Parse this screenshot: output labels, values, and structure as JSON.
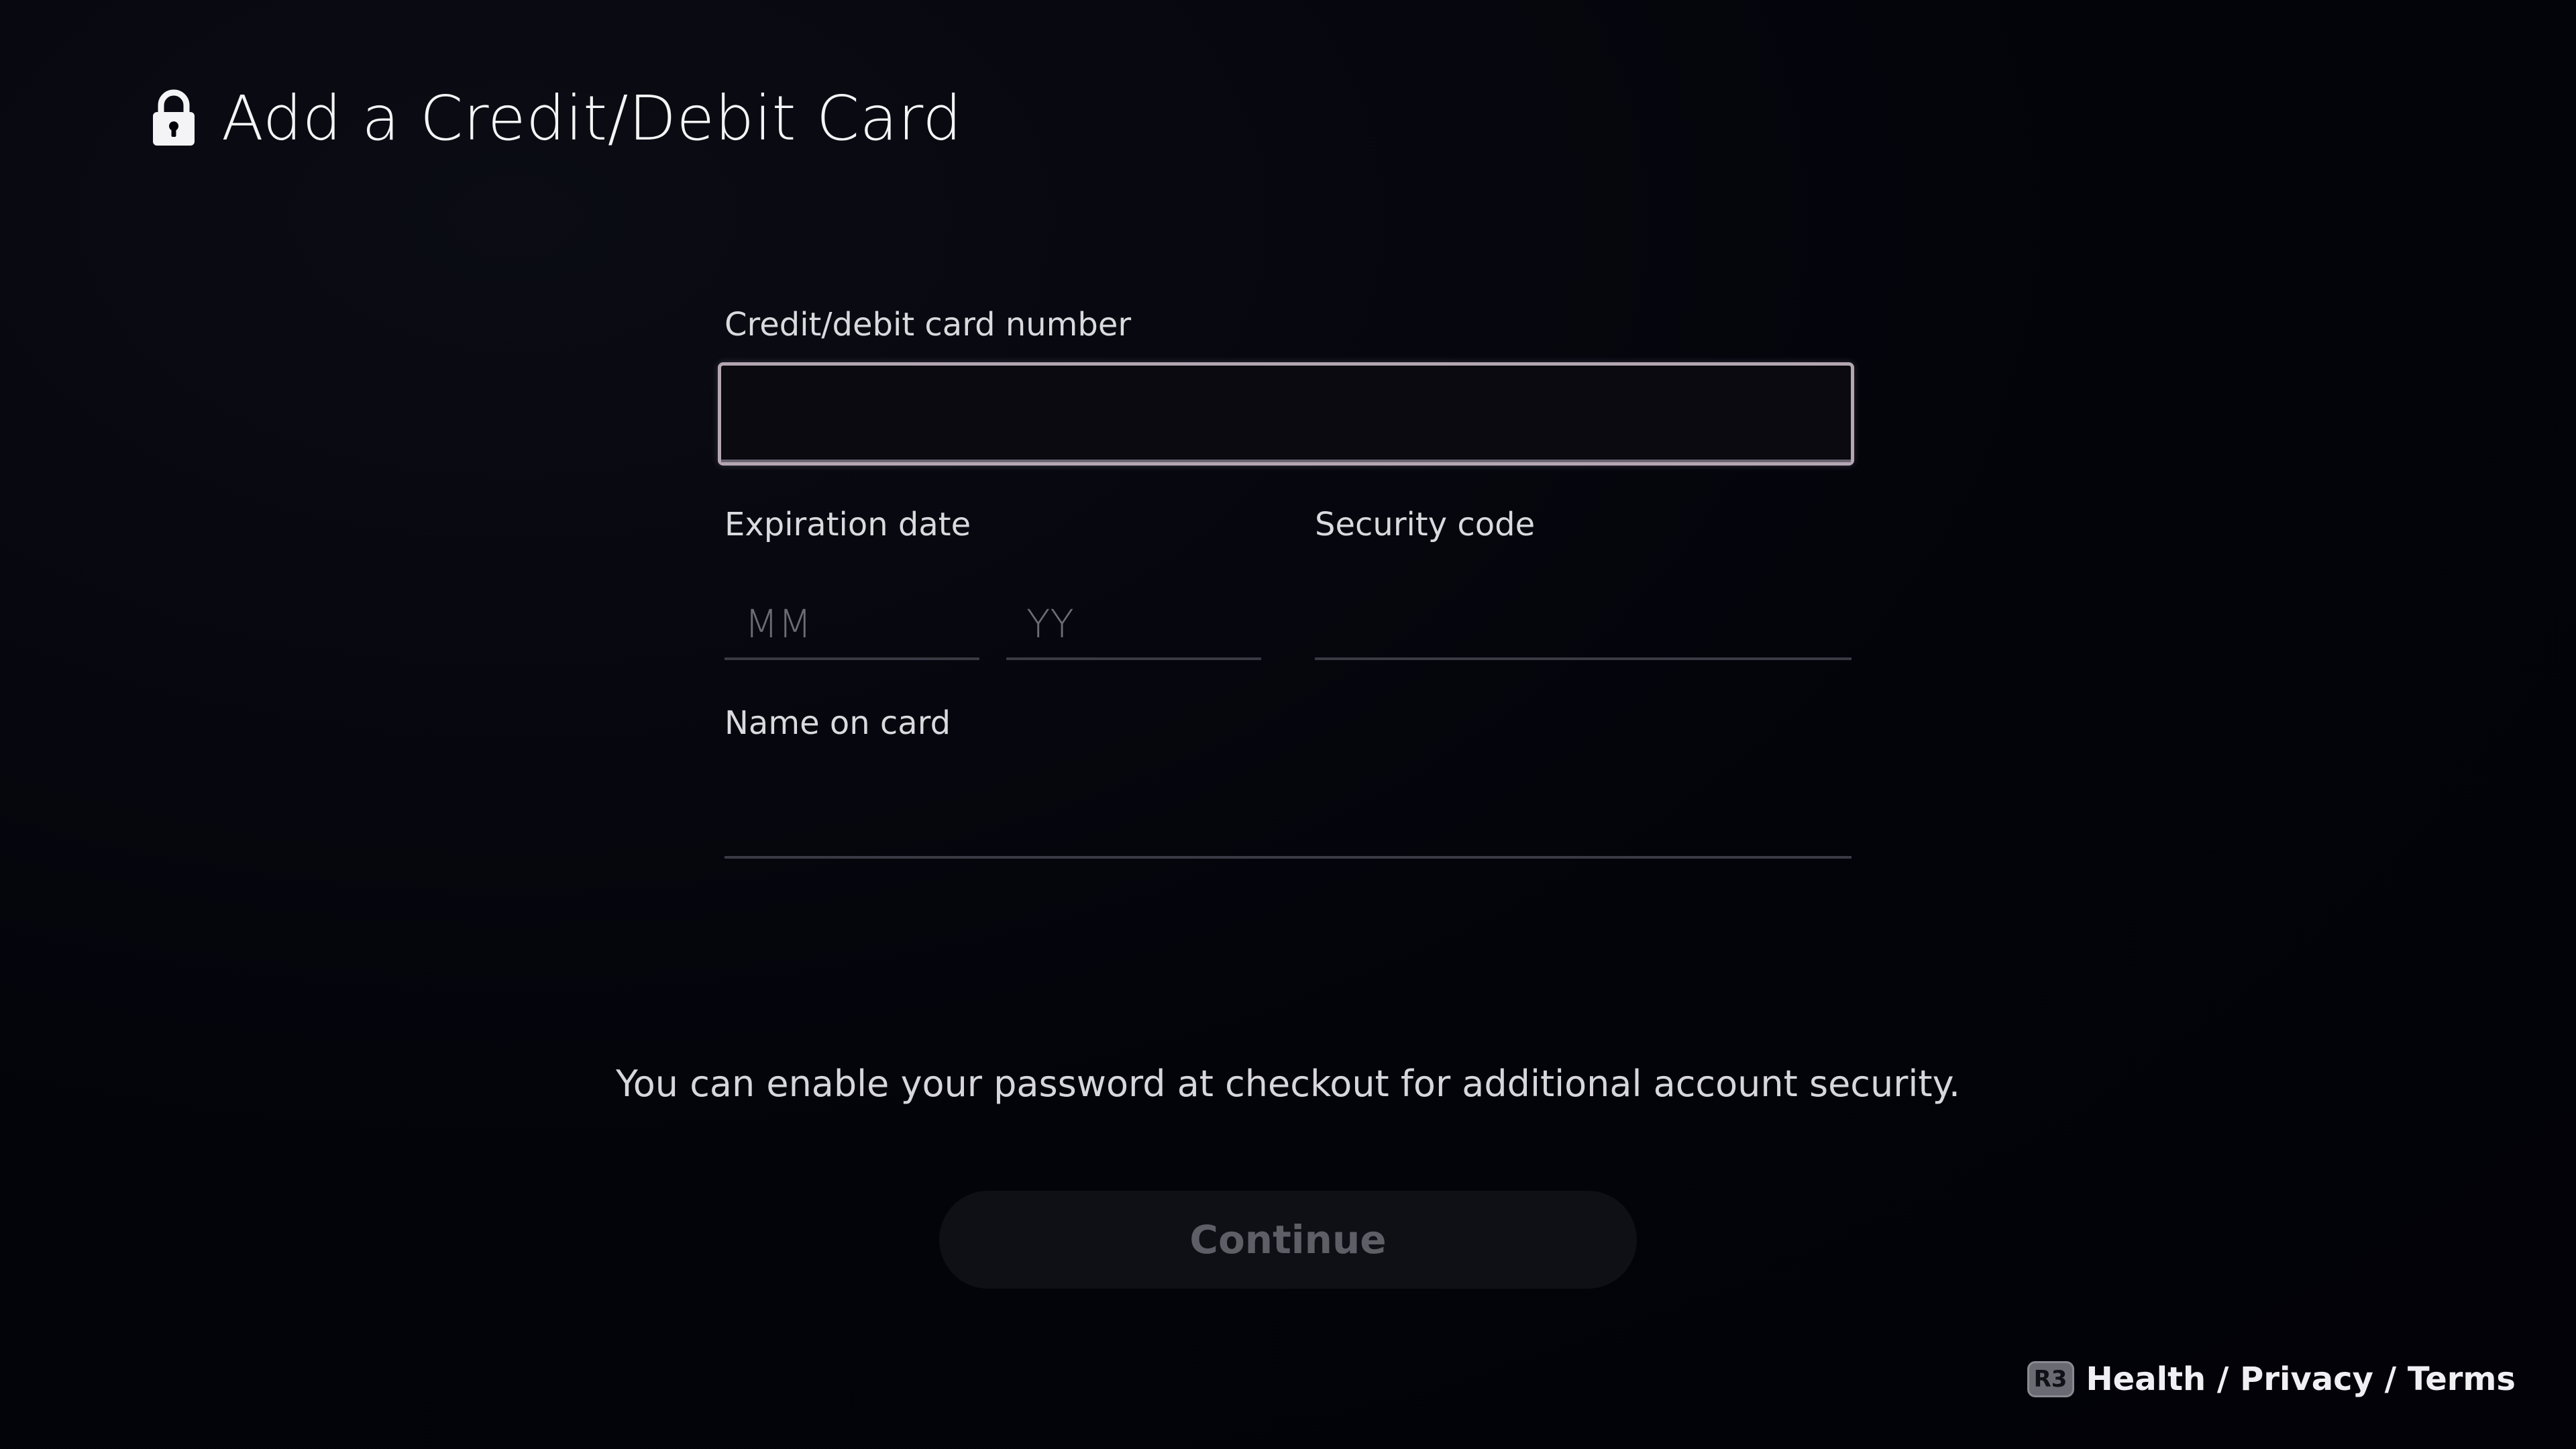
{
  "header": {
    "title": "Add a Credit/Debit Card",
    "icon": "lock-icon"
  },
  "form": {
    "card_number": {
      "label": "Credit/debit card number",
      "value": ""
    },
    "expiration": {
      "label": "Expiration date",
      "month_placeholder": "MM",
      "year_placeholder": "YY"
    },
    "security_code": {
      "label": "Security code",
      "value": ""
    },
    "name_on_card": {
      "label": "Name on card",
      "value": ""
    }
  },
  "info_text": "You can enable your password at checkout for additional account security.",
  "continue_label": "Continue",
  "footer": {
    "button_glyph": "R3",
    "link_text": "Health / Privacy / Terms"
  },
  "colors": {
    "background": "#03030a",
    "focus_border": "#b4a7b2",
    "button_bg": "#0f0f16",
    "button_text_disabled": "#5e5e66"
  }
}
